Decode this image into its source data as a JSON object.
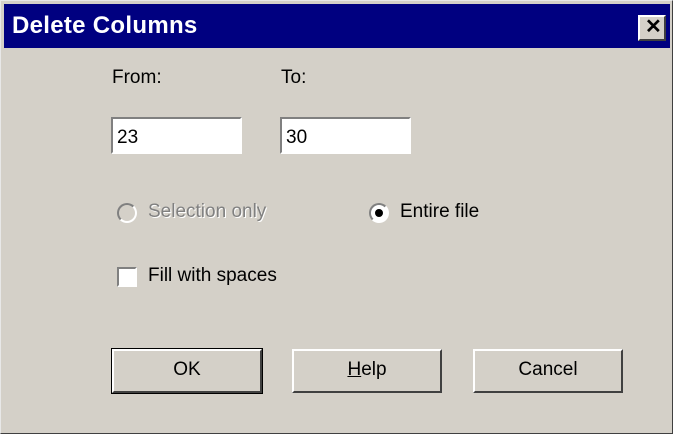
{
  "window": {
    "title": "Delete Columns",
    "close_symbol": "✕"
  },
  "from": {
    "label": "From:",
    "value": "23"
  },
  "to": {
    "label": "To:",
    "value": "30"
  },
  "options": {
    "selection_only": {
      "label": "Selection only",
      "selected": false,
      "enabled": false
    },
    "entire_file": {
      "label": "Entire file",
      "selected": true,
      "enabled": true
    }
  },
  "fill_with_spaces": {
    "label": "Fill with spaces",
    "checked": false
  },
  "buttons": {
    "ok": "OK",
    "help_mnemonic": "H",
    "help_rest": "elp",
    "cancel": "Cancel"
  }
}
